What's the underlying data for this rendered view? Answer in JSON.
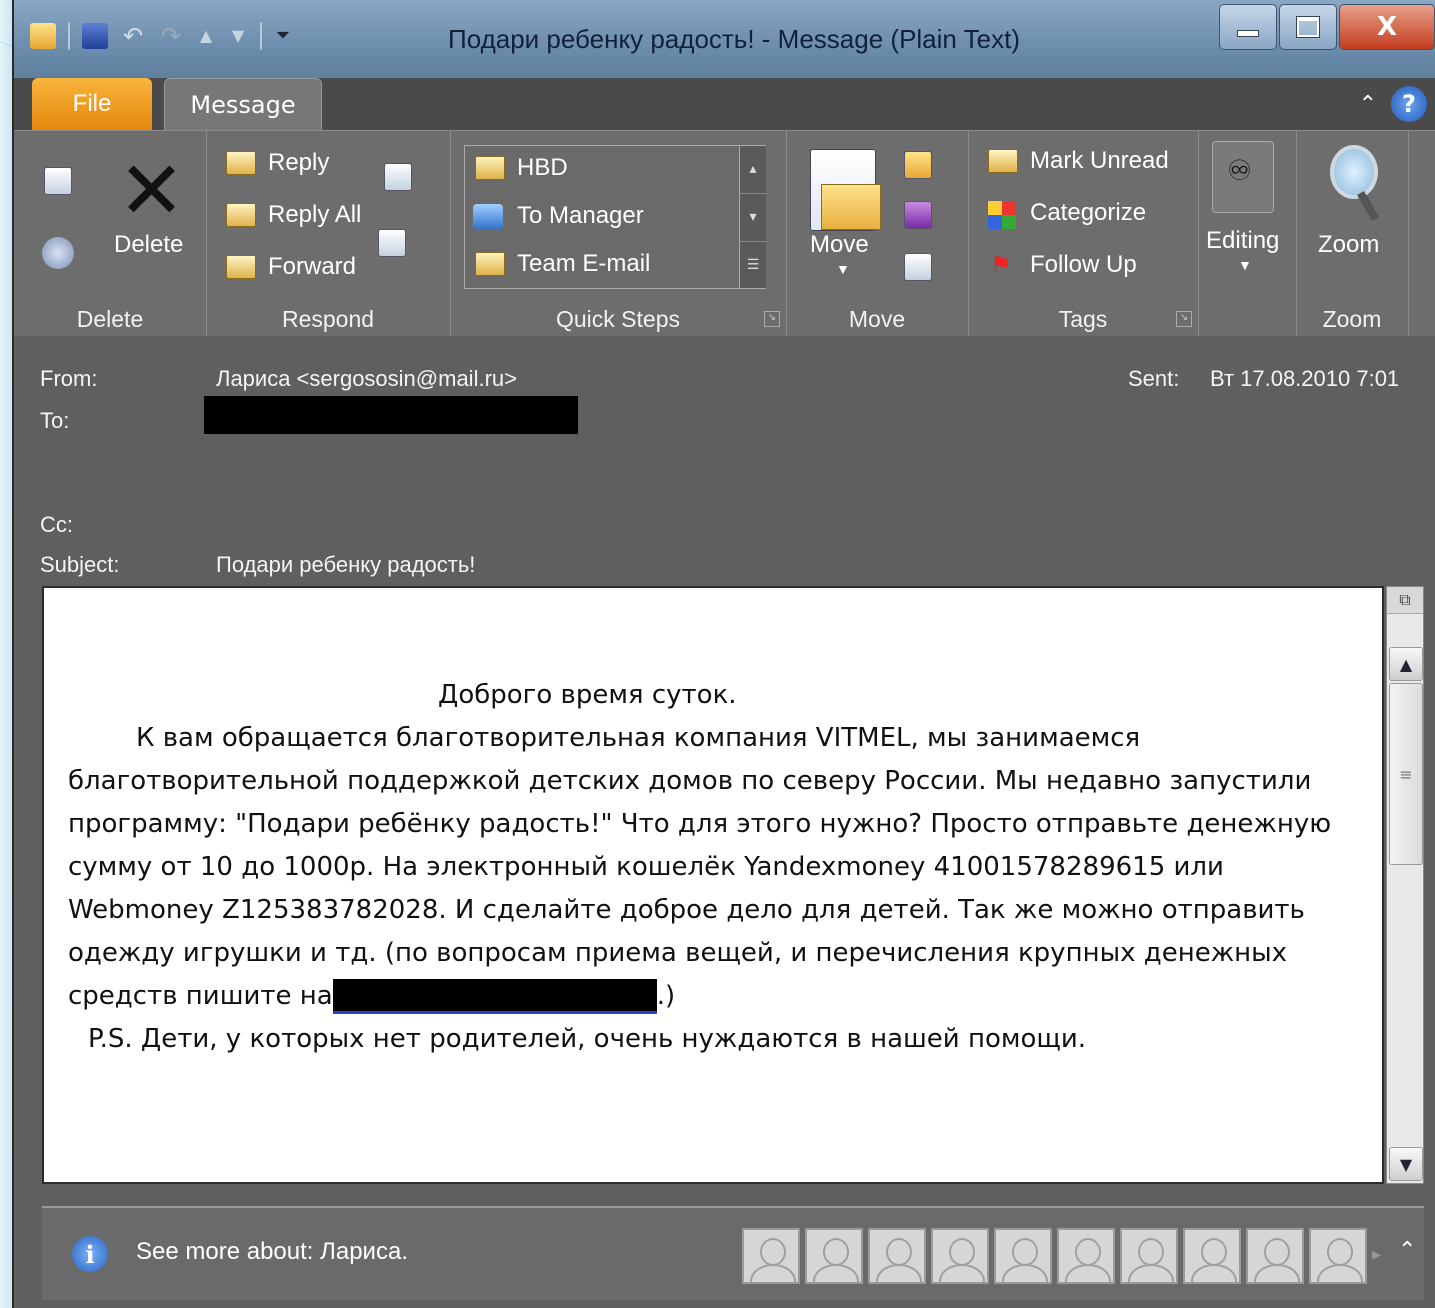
{
  "window": {
    "title": "Подари ребенку радость!  -  Message (Plain Text)",
    "close_label": "X"
  },
  "tabs": {
    "file": "File",
    "message": "Message"
  },
  "ribbon": {
    "delete_group": {
      "delete_label": "Delete",
      "group_label": "Delete"
    },
    "respond_group": {
      "reply": "Reply",
      "reply_all": "Reply All",
      "forward": "Forward",
      "group_label": "Respond"
    },
    "quick_steps": {
      "items": [
        "HBD",
        "To Manager",
        "Team E-mail"
      ],
      "group_label": "Quick Steps"
    },
    "move_group": {
      "move_label": "Move",
      "group_label": "Move"
    },
    "tags_group": {
      "mark_unread": "Mark Unread",
      "categorize": "Categorize",
      "follow_up": "Follow Up",
      "group_label": "Tags"
    },
    "editing": {
      "label": "Editing"
    },
    "zoom_group": {
      "zoom_label": "Zoom",
      "group_label": "Zoom"
    }
  },
  "header": {
    "from_label": "From:",
    "from_value": "Лариса <sergososin@mail.ru>",
    "to_label": "To:",
    "cc_label": "Cc:",
    "subject_label": "Subject:",
    "subject_value": "Подари ребенку радость!",
    "sent_label": "Sent:",
    "sent_value": "Вт 17.08.2010 7:01"
  },
  "body": {
    "greeting": "Доброго время суток.",
    "line1": "К вам обращается благотворительная компания VITMEL, мы занимаемся",
    "line2": "благотворительной поддержкой детских домов по северу России. Мы недавно запустили",
    "line3": "программу: \"Подари ребёнку радость!\" Что для этого нужно? Просто отправьте денежную",
    "line4": "сумму от 10 до 1000р. На электронный кошелёк Yandexmoney 41001578289615 или",
    "line5": "Webmoney Z125383782028. И сделайте доброе дело для детей. Так же можно отправить",
    "line6": "одежду  игрушки и тд. (по вопросам приема вещей, и перечисления крупных денежных",
    "line7_prefix": "средств пишите на",
    "line7_suffix": ".)",
    "ps": "P.S.  Дети, у которых нет родителей, очень нуждаются в нашей помощи."
  },
  "people_pane": {
    "see_more": "See more about: Лариса."
  },
  "colors": {
    "file_tab": "#e5860d",
    "ribbon_bg": "#6d6d6d",
    "header_bg": "#5f5f5f",
    "redaction": "#000000",
    "link_underline": "#2b3fd0"
  }
}
